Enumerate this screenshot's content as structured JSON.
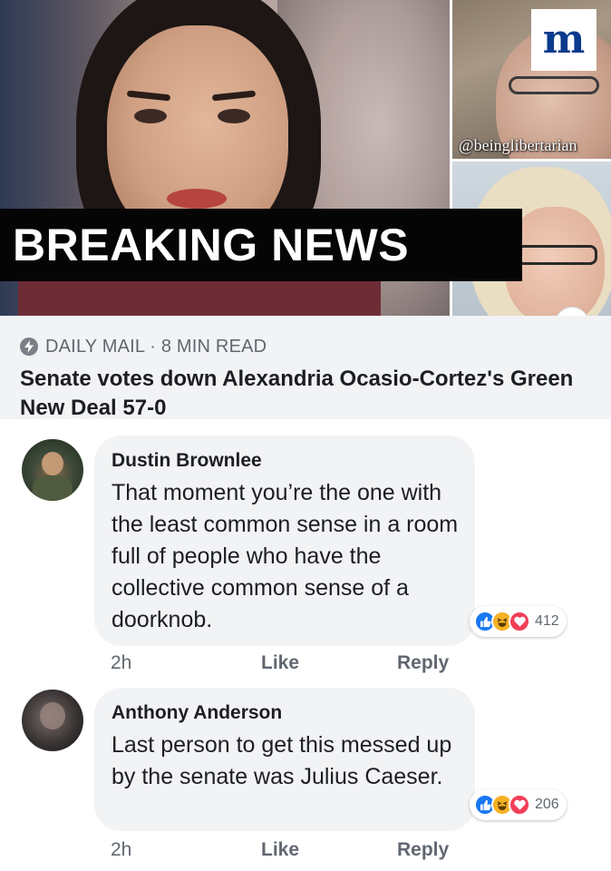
{
  "post": {
    "banner_text": "BREAKING NEWS",
    "watermark": "@beinglibertarian",
    "logo_letter": "m",
    "info_glyph": "i",
    "source": "DAILY MAIL · 8 MIN READ",
    "headline": "Senate votes down Alexandria Ocasio-Cortez's Green New Deal 57-0"
  },
  "comments": [
    {
      "author": "Dustin Brownlee",
      "text": "That moment you’re the one with the least common sense in a room full of people who have the collective common sense of a doorknob.",
      "reaction_count": "412",
      "time": "2h",
      "like_label": "Like",
      "reply_label": "Reply"
    },
    {
      "author": "Anthony Anderson",
      "text": "Last person to get this messed up by the senate was Julius Caeser.",
      "reaction_count": "206",
      "time": "2h",
      "like_label": "Like",
      "reply_label": "Reply"
    }
  ],
  "reaction_icons": [
    "like-icon",
    "haha-icon",
    "love-icon"
  ],
  "colors": {
    "like": "#1877f2",
    "haha": "#f7b125",
    "love": "#f33e58",
    "bubble": "#f2f3f5",
    "banner": "#050505",
    "logo": "#0a3a8c"
  }
}
